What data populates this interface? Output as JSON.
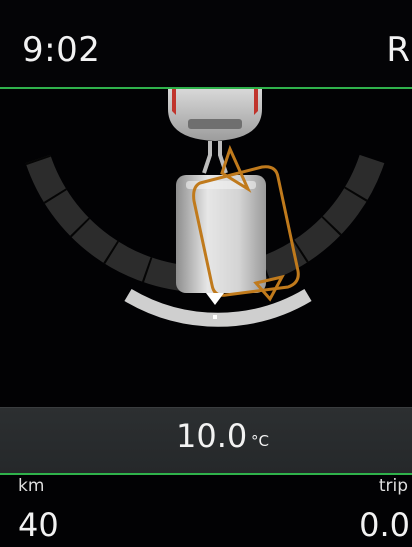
{
  "header": {
    "time": "9:02",
    "gear": "R"
  },
  "parking_view": {
    "towed_vehicle_icon": "trailer-icon",
    "tow_vehicle_icon": "car-rear-icon",
    "accent_color": "#2fb24b",
    "trajectory_color": "#c07a1c"
  },
  "temperature": {
    "value": "10.0",
    "unit": "°C"
  },
  "info": {
    "left_label": "km",
    "left_value": "40",
    "right_label": "trip",
    "right_value": "0.0"
  }
}
